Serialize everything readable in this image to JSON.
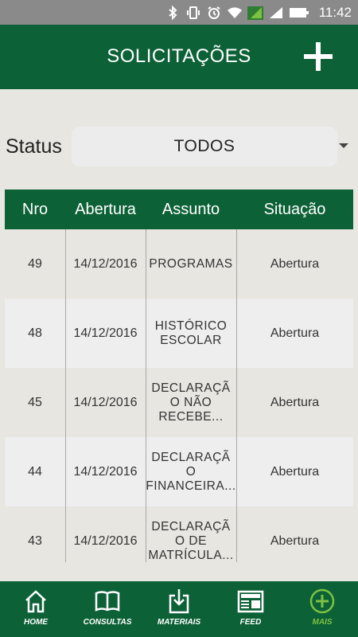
{
  "status_bar": {
    "time": "11:42"
  },
  "header": {
    "title": "SOLICITAÇÕES"
  },
  "filter": {
    "label": "Status",
    "selected": "TODOS"
  },
  "table": {
    "columns": [
      "Nro",
      "Abertura",
      "Assunto",
      "Situação"
    ],
    "rows": [
      {
        "nro": "49",
        "abertura": "14/12/2016",
        "assunto_lines": [
          "PROGRAMAS"
        ],
        "situacao": "Abertura"
      },
      {
        "nro": "48",
        "abertura": "14/12/2016",
        "assunto_lines": [
          "HISTÓRICO",
          "ESCOLAR"
        ],
        "situacao": "Abertura"
      },
      {
        "nro": "45",
        "abertura": "14/12/2016",
        "assunto_lines": [
          "DECLARAÇÃ",
          "O NÃO",
          "RECEBE..."
        ],
        "situacao": "Abertura"
      },
      {
        "nro": "44",
        "abertura": "14/12/2016",
        "assunto_lines": [
          "DECLARAÇÃ",
          "O",
          "FINANCEIRA..."
        ],
        "situacao": "Abertura"
      },
      {
        "nro": "43",
        "abertura": "14/12/2016",
        "assunto_lines": [
          "DECLARAÇÃ",
          "O DE",
          "MATRÍCULA..."
        ],
        "situacao": "Abertura"
      }
    ]
  },
  "bottom_nav": {
    "items": [
      {
        "label": "HOME",
        "icon": "home-icon"
      },
      {
        "label": "CONSULTAS",
        "icon": "book-icon"
      },
      {
        "label": "MATERIAIS",
        "icon": "download-icon"
      },
      {
        "label": "FEED",
        "icon": "news-icon"
      },
      {
        "label": "MAIS",
        "icon": "plus-circle-icon",
        "active": true
      }
    ]
  },
  "colors": {
    "primary": "#0d6137",
    "accent": "#7cc242",
    "background": "#e7e6e0"
  }
}
